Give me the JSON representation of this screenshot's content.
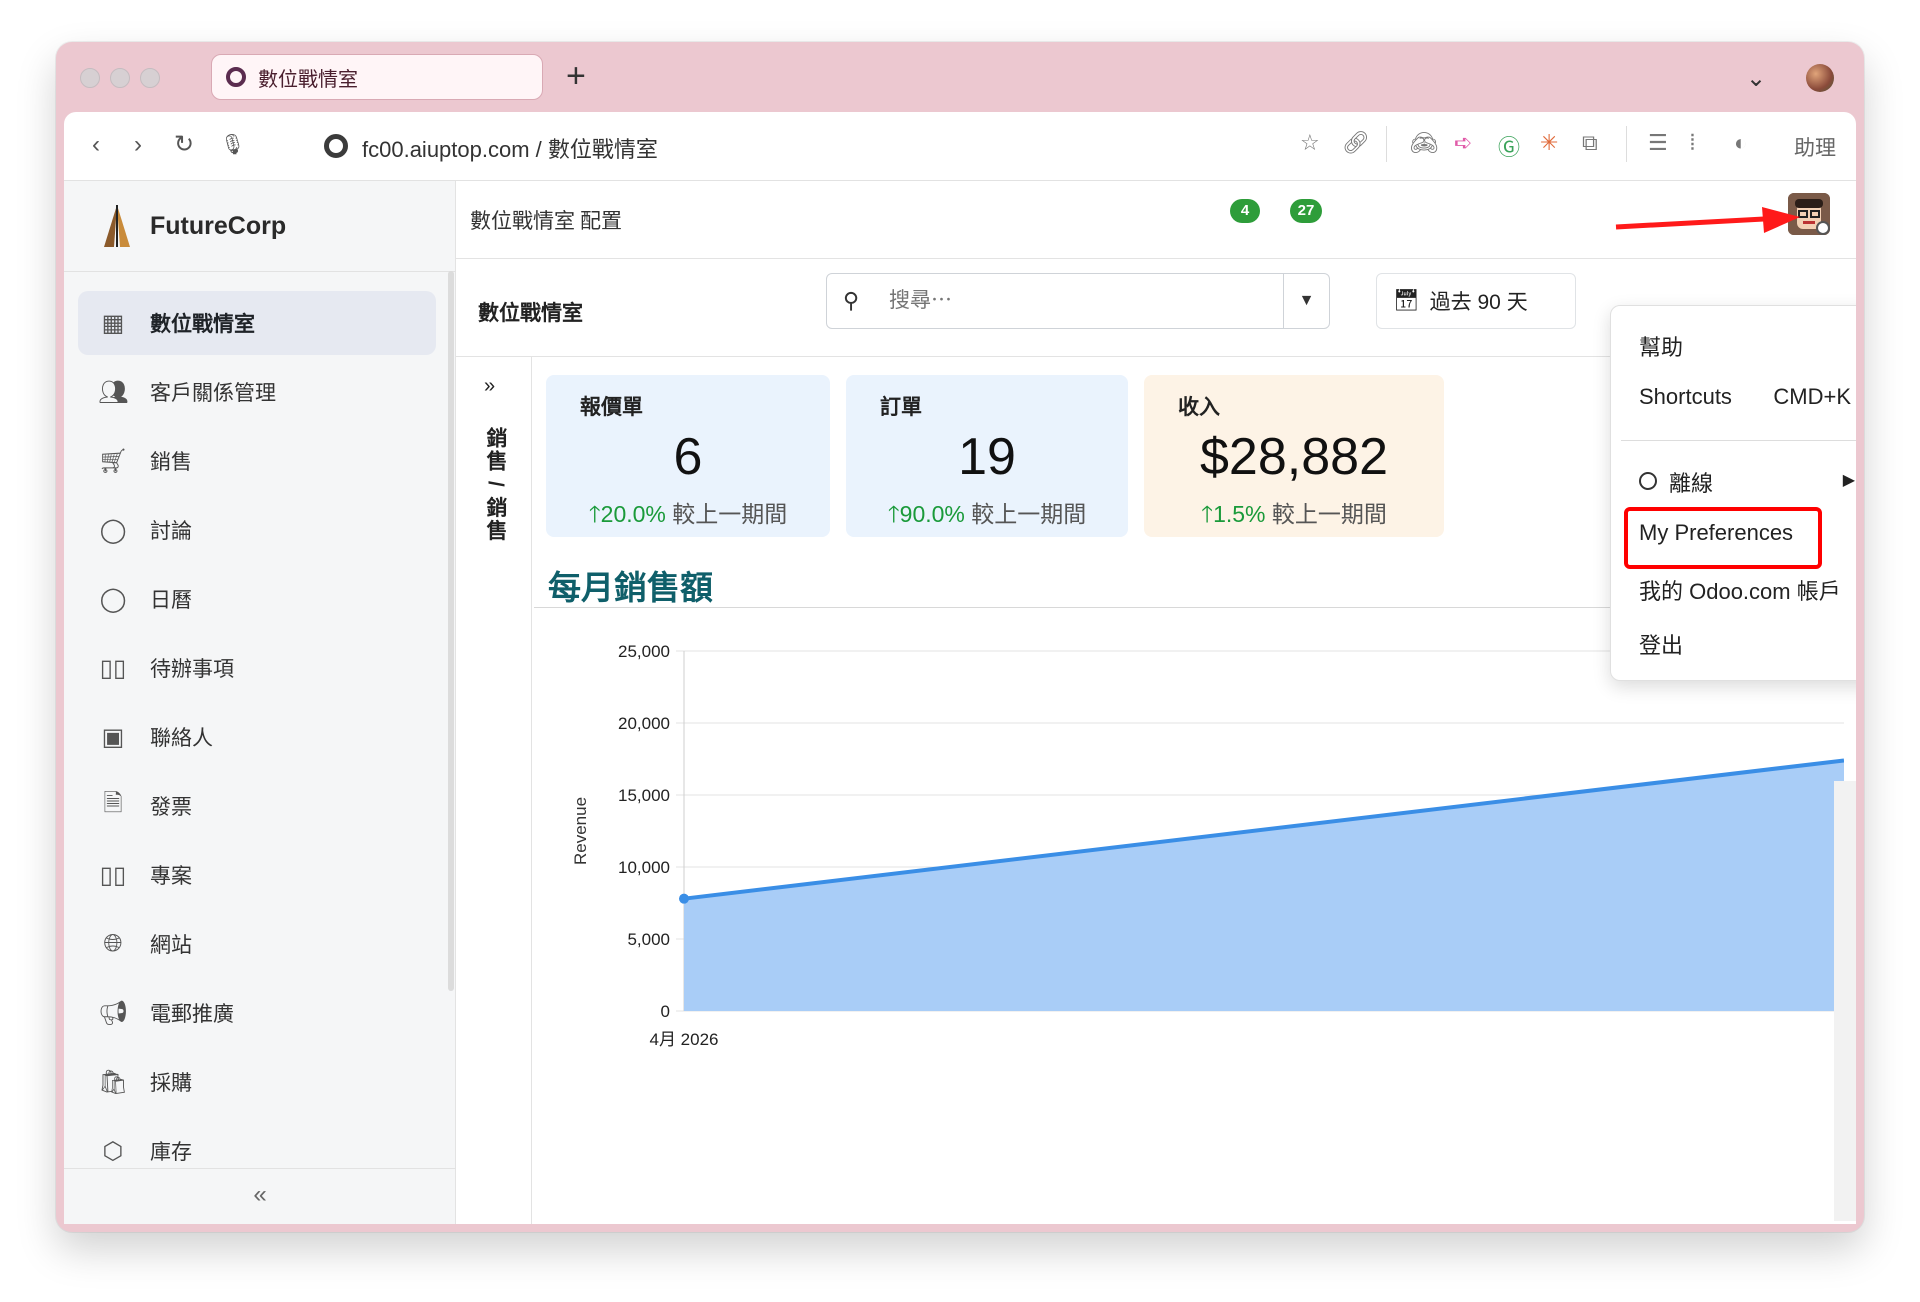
{
  "browser": {
    "tab_title": "數位戰情室",
    "new_tab_label": "+",
    "address": "fc00.aiuptop.com / 數位戰情室",
    "assistant_label": "助理"
  },
  "sidebar": {
    "brand": "FutureCorp",
    "items": [
      {
        "label": "數位戰情室",
        "icon": "grid-icon"
      },
      {
        "label": "客戶關係管理",
        "icon": "users-icon"
      },
      {
        "label": "銷售",
        "icon": "cart-icon"
      },
      {
        "label": "討論",
        "icon": "chat-icon"
      },
      {
        "label": "日曆",
        "icon": "chat-icon"
      },
      {
        "label": "待辦事項",
        "icon": "kanban-icon"
      },
      {
        "label": "聯絡人",
        "icon": "contact-card-icon"
      },
      {
        "label": "發票",
        "icon": "document-icon"
      },
      {
        "label": "專案",
        "icon": "kanban-icon"
      },
      {
        "label": "網站",
        "icon": "globe-icon"
      },
      {
        "label": "電郵推廣",
        "icon": "megaphone-icon"
      },
      {
        "label": "採購",
        "icon": "bag-icon"
      },
      {
        "label": "庫存",
        "icon": "box-icon"
      }
    ],
    "collapse_label": "«"
  },
  "topnav": {
    "items": [
      "數位戰情室",
      "配置"
    ],
    "badges": [
      "4",
      "27"
    ]
  },
  "control_panel": {
    "title": "數位戰情室",
    "search_placeholder": "搜尋⋯",
    "period": "過去 90 天"
  },
  "filter_panel": {
    "toggle": "»",
    "label": "銷售 / 銷售"
  },
  "kpis": [
    {
      "title": "報價單",
      "value": "6",
      "change": "20.0%",
      "suffix": "較上一期間"
    },
    {
      "title": "訂單",
      "value": "19",
      "change": "90.0%",
      "suffix": "較上一期間"
    },
    {
      "title": "收入",
      "value": "$28,882",
      "change": "1.5%",
      "suffix": "較上一期間"
    }
  ],
  "section_title": "每月銷售額",
  "chart_data": {
    "type": "area",
    "x": [
      "4月 2026"
    ],
    "series": [
      {
        "values": [
          7800,
          17400
        ]
      }
    ],
    "ylabel": "Revenue",
    "xlabel": "",
    "yticks": [
      "25,000",
      "20,000",
      "15,000",
      "10,000",
      "5,000",
      "0"
    ],
    "ylim": [
      0,
      25000
    ],
    "grid": true,
    "colors": {
      "line": "#3a8ee6",
      "fill": "#a9cdf7"
    }
  },
  "user_menu": {
    "help": "幫助",
    "shortcuts": "Shortcuts",
    "shortcut_key": "CMD+K",
    "status": "離線",
    "preferences": "My Preferences",
    "account": "我的 Odoo.com 帳戶",
    "logout": "登出"
  },
  "colors": {
    "window": "#ecc8d0",
    "badge": "#2e9d3a",
    "kpi_blue": "#eaf3fd",
    "kpi_orange": "#fdf3e6",
    "highlight": "#ff0000"
  }
}
